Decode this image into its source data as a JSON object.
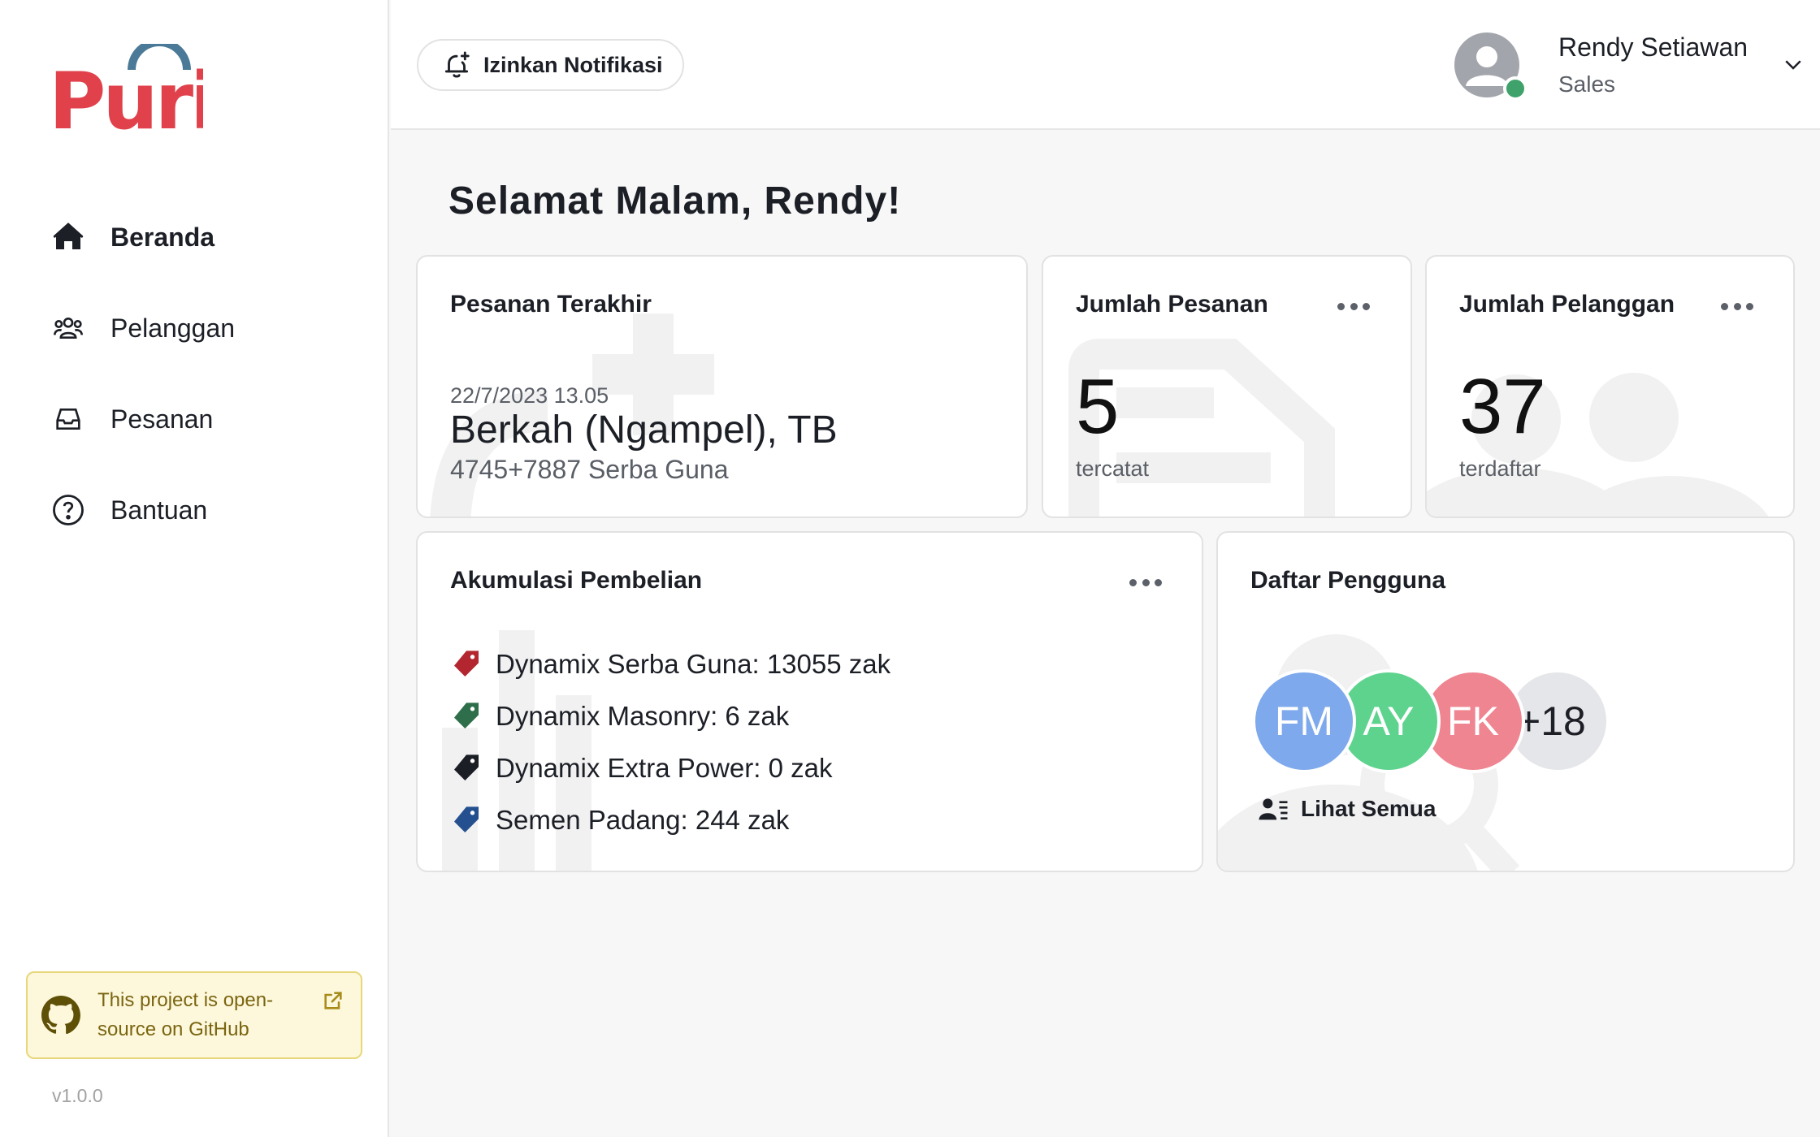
{
  "brand": {
    "logo_text": "Puri",
    "logo_color": "#e0414b",
    "arc_color": "#4a7a97"
  },
  "nav": {
    "items": [
      {
        "label": "Beranda",
        "icon": "home-icon",
        "active": true
      },
      {
        "label": "Pelanggan",
        "icon": "users-icon",
        "active": false
      },
      {
        "label": "Pesanan",
        "icon": "inbox-icon",
        "active": false
      },
      {
        "label": "Bantuan",
        "icon": "help-icon",
        "active": false
      }
    ]
  },
  "github": {
    "text": "This project is open-source on GitHub",
    "icon": "github-icon"
  },
  "version": "v1.0.0",
  "header": {
    "notif_label": "Izinkan Notifikasi",
    "user_name": "Rendy Setiawan",
    "user_role": "Sales",
    "status_color": "#3fa26a"
  },
  "greeting": "Selamat Malam, Rendy!",
  "cards": {
    "last_order": {
      "title": "Pesanan Terakhir",
      "date": "22/7/2023 13.05",
      "customer": "Berkah (Ngampel), TB",
      "product": "4745+7887 Serba Guna"
    },
    "orders": {
      "title": "Jumlah Pesanan",
      "value": "5",
      "sub": "tercatat"
    },
    "customers": {
      "title": "Jumlah Pelanggan",
      "value": "37",
      "sub": "terdaftar"
    },
    "accumulation": {
      "title": "Akumulasi Pembelian",
      "items": [
        {
          "text": "Dynamix Serba Guna: 13055 zak",
          "color": "#b3262f"
        },
        {
          "text": "Dynamix Masonry: 6 zak",
          "color": "#2e6e4a"
        },
        {
          "text": "Dynamix Extra Power: 0 zak",
          "color": "#1b1e25"
        },
        {
          "text": "Semen Padang: 244 zak",
          "color": "#24508f"
        }
      ]
    },
    "users": {
      "title": "Daftar Pengguna",
      "avatars": [
        {
          "initials": "FM",
          "color": "#7ea9ec"
        },
        {
          "initials": "AY",
          "color": "#5ed38e"
        },
        {
          "initials": "FK",
          "color": "#ef8591"
        }
      ],
      "more": "+18",
      "see_all": "Lihat Semua"
    }
  }
}
